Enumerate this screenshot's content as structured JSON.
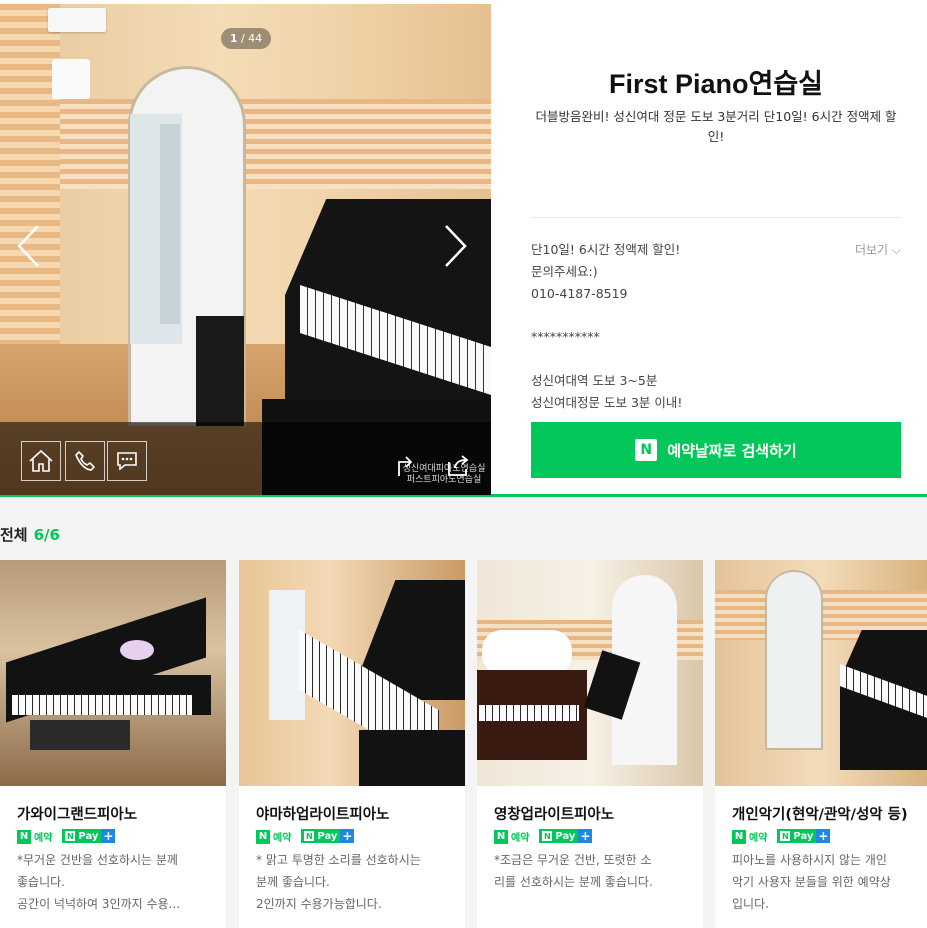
{
  "gallery": {
    "counter_current": "1",
    "counter_total": " / 44",
    "watermark_line1": "성신여대피아노연습실",
    "watermark_line2": "퍼스트피아노연습실"
  },
  "shop": {
    "title": "First Piano연습실",
    "description": "더블방음완비! 성신여대 정문 도보 3분거리 단10일! 6시간 정액제 할인!",
    "more_label": "더보기",
    "notice_lines": [
      "단10일! 6시간 정액제 할인!",
      "문의주세요:)",
      "010-4187-8519"
    ],
    "separator": "***********",
    "location_lines": [
      "성신여대역 도보 3~5분",
      "성신여대정문 도보 3분 이내!"
    ],
    "book_label": "예약날짜로 검색하기",
    "accent_color": "#03c75a"
  },
  "list": {
    "label": "전체",
    "count": "6/6",
    "badges": {
      "reserve": "예약",
      "pay": "Pay",
      "plus": "+"
    },
    "items": [
      {
        "name": "가와이그랜드피아노",
        "desc": [
          "*무거운 건반을 선호하시는 분께",
          "좋습니다.",
          "공간이 넉넉하여 3인까지 수용..."
        ]
      },
      {
        "name": "야마하업라이트피아노",
        "desc": [
          "* 맑고 투명한 소리를 선호하시는",
          "분께 좋습니다.",
          "2인까지 수용가능합니다."
        ]
      },
      {
        "name": "영창업라이트피아노",
        "desc": [
          "*조금은 무거운 건반, 또렷한 소",
          "리를 선호하시는 분께 좋습니다."
        ]
      },
      {
        "name": "개인악기(현악/관악/성악 등)",
        "desc": [
          "피아노를 사용하시지 않는 개인",
          "악기 사용자 분들을 위한 예약상",
          "입니다."
        ]
      }
    ]
  }
}
